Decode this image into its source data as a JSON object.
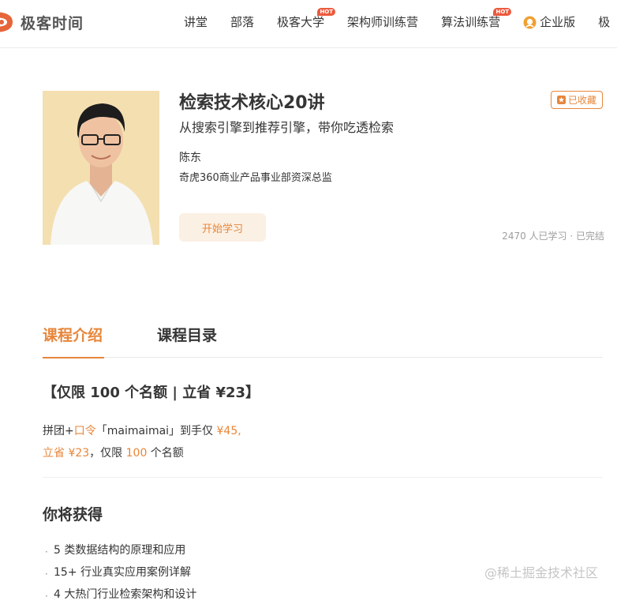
{
  "nav": {
    "logo_text": "极客时间",
    "items": [
      {
        "label": "讲堂",
        "hot": ""
      },
      {
        "label": "部落",
        "hot": ""
      },
      {
        "label": "极客大学",
        "hot": "HOT"
      },
      {
        "label": "架构师训练营",
        "hot": ""
      },
      {
        "label": "算法训练营",
        "hot": "HOT"
      },
      {
        "label": "企业版",
        "hot": ""
      },
      {
        "label": "极",
        "hot": ""
      }
    ]
  },
  "course": {
    "title": "检索技术核心20讲",
    "subtitle": "从搜索引擎到推荐引擎，带你吃透检索",
    "author": "陈东",
    "author_title": "奇虎360商业产品事业部资深总监",
    "start_label": "开始学习",
    "favorite_label": "已收藏",
    "learn_stat": "2470 人已学习 · 已完结"
  },
  "tabs": [
    {
      "label": "课程介绍"
    },
    {
      "label": "课程目录"
    }
  ],
  "intro": {
    "promo_title": "【仅限 100 个名额 | 立省 ¥23】",
    "line1": {
      "a": "拼团+",
      "b": "口令",
      "c": "「maimaimai」到手仅 ",
      "d": "¥45,"
    },
    "line2": {
      "a": "立省 ¥23",
      "b": "，仅限 ",
      "c": "100",
      "d": " 个名额"
    },
    "gain_title": "你将获得",
    "gains": [
      "5 类数据结构的原理和应用",
      "15+ 行业真实应用案例详解",
      "4 大热门行业检索架构和设计"
    ]
  },
  "watermark": "@稀土掘金技术社区",
  "colors": {
    "accent": "#e7863a",
    "hot_badge": "#ec5a3e",
    "cover_bg": "#f4dfb0"
  }
}
